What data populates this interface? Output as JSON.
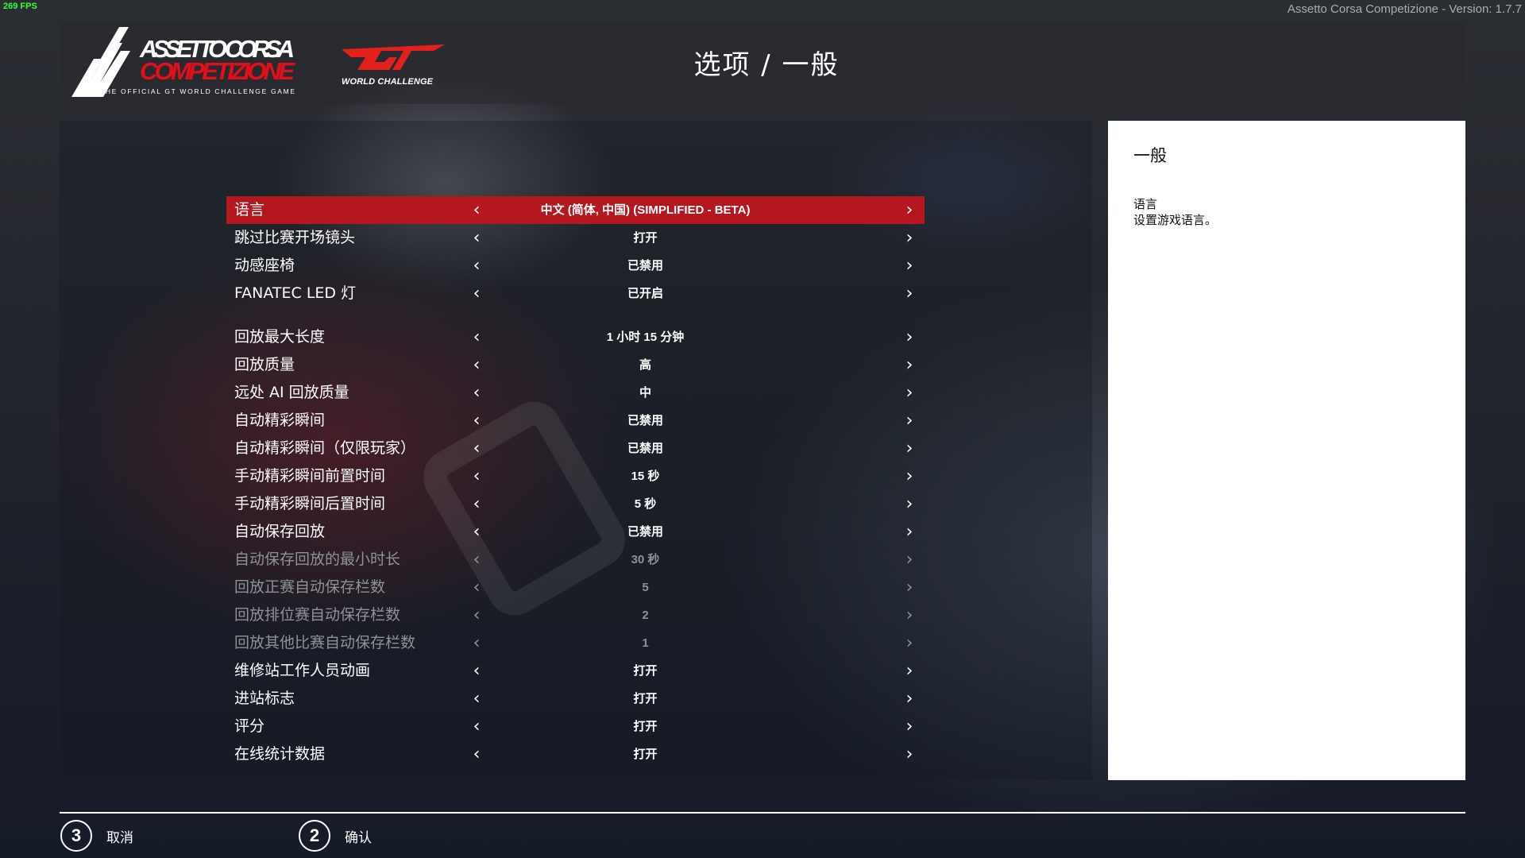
{
  "overlay": {
    "fps": "269 FPS",
    "version": "Assetto Corsa Competizione - Version: 1.7.7"
  },
  "header": {
    "logo_main_line1": "ASSETTO CORSA",
    "logo_main_line2": "COMPETIZIONE",
    "logo_tagline": "THE OFFICIAL GT WORLD CHALLENGE GAME",
    "logo_gt": "GT",
    "logo_gt_sub": "WORLD CHALLENGE",
    "title": "选项 / 一般"
  },
  "colors": {
    "accent": "#b4171f",
    "disabled_text": "#8e9297"
  },
  "settings": [
    {
      "label": "语言",
      "value": "中文 (简体, 中国) (SIMPLIFIED - BETA)",
      "state": "active"
    },
    {
      "label": "跳过比赛开场镜头",
      "value": "打开",
      "state": "normal"
    },
    {
      "label": "动感座椅",
      "value": "已禁用",
      "state": "normal"
    },
    {
      "label": "FANATEC LED 灯",
      "value": "已开启",
      "state": "normal"
    },
    {
      "label": "回放最大长度",
      "value": "1 小时 15 分钟",
      "state": "normal"
    },
    {
      "label": "回放质量",
      "value": "高",
      "state": "normal"
    },
    {
      "label": "远处 AI 回放质量",
      "value": "中",
      "state": "normal"
    },
    {
      "label": "自动精彩瞬间",
      "value": "已禁用",
      "state": "normal"
    },
    {
      "label": "自动精彩瞬间（仅限玩家）",
      "value": "已禁用",
      "state": "normal"
    },
    {
      "label": "手动精彩瞬间前置时间",
      "value": "15 秒",
      "state": "normal"
    },
    {
      "label": "手动精彩瞬间后置时间",
      "value": "5 秒",
      "state": "normal"
    },
    {
      "label": "自动保存回放",
      "value": "已禁用",
      "state": "normal"
    },
    {
      "label": "自动保存回放的最小时长",
      "value": "30 秒",
      "state": "disabled"
    },
    {
      "label": "回放正赛自动保存栏数",
      "value": "5",
      "state": "disabled"
    },
    {
      "label": "回放排位赛自动保存栏数",
      "value": "2",
      "state": "disabled"
    },
    {
      "label": "回放其他比赛自动保存栏数",
      "value": "1",
      "state": "disabled"
    },
    {
      "label": "维修站工作人员动画",
      "value": "打开",
      "state": "normal"
    },
    {
      "label": "进站标志",
      "value": "打开",
      "state": "normal"
    },
    {
      "label": "评分",
      "value": "打开",
      "state": "normal"
    },
    {
      "label": "在线统计数据",
      "value": "打开",
      "state": "normal"
    }
  ],
  "arrows": {
    "prev": "‹",
    "next": "›",
    "prev_icon": "chevron-left-icon",
    "next_icon": "chevron-right-icon"
  },
  "help_panel": {
    "title": "一般",
    "item_name": "语言",
    "item_desc": "设置游戏语言。"
  },
  "footer": {
    "cancel": {
      "key": "3",
      "label": "取消"
    },
    "confirm": {
      "key": "2",
      "label": "确认"
    }
  }
}
